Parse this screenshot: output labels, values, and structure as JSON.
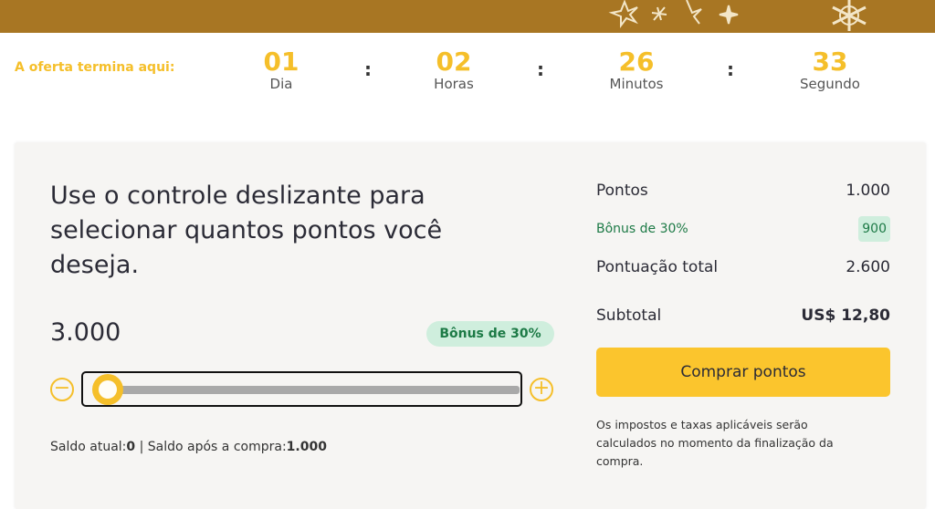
{
  "countdown": {
    "label": "A oferta termina aqui:",
    "units": [
      {
        "value": "01",
        "label": "Dia"
      },
      {
        "value": "02",
        "label": "Horas"
      },
      {
        "value": "26",
        "label": "Minutos"
      },
      {
        "value": "33",
        "label": "Segundo"
      }
    ],
    "separator": ":"
  },
  "selector": {
    "headline": "Use o controle deslizante para selecionar quantos pontos você deseja.",
    "points_value": "3.000",
    "bonus_badge": "Bônus de 30%",
    "slider_level_fraction": 0.0,
    "balance_current_label": "Saldo atual:",
    "balance_current_value": "0",
    "balance_divider": "|",
    "balance_after_label": "Saldo após a compra:",
    "balance_after_value": "1.000"
  },
  "summary": {
    "points_label": "Pontos",
    "points_value": "1.000",
    "bonus_label": "Bônus de 30%",
    "bonus_value": "900",
    "total_label": "Pontuação total",
    "total_value": "2.600",
    "subtotal_label": "Subtotal",
    "subtotal_value": "US$ 12,80",
    "buy_button": "Comprar pontos",
    "tax_note": "Os impostos e taxas aplicáveis serão calculados no momento da finalização da compra."
  },
  "colors": {
    "banner": "#a87623",
    "accent": "#f5bf2a",
    "bonus_green": "#1d7a46",
    "bonus_bg": "#cfeedd"
  },
  "icons": {
    "minus": "minus-circle-icon",
    "plus": "plus-circle-icon",
    "banner_decoration": "snowflake-star-icon"
  }
}
